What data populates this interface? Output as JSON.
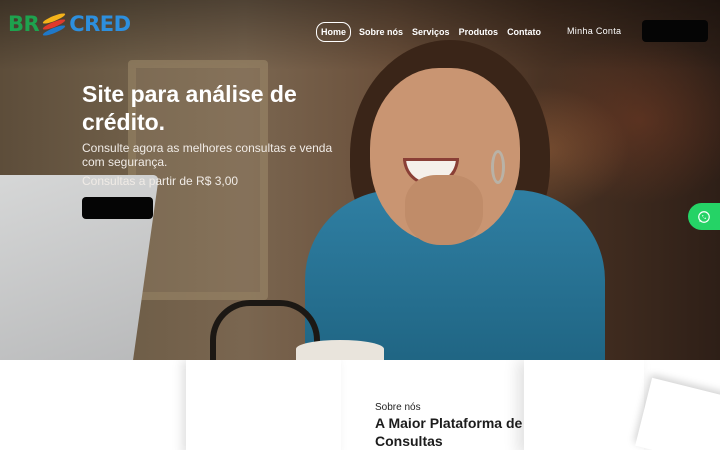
{
  "brand": {
    "logo_left": "BR",
    "logo_right": "CRED",
    "colors": {
      "green": "#1ea24e",
      "blue": "#2d8fde",
      "whatsapp": "#25d366",
      "button": "#050505"
    }
  },
  "nav": {
    "links": [
      {
        "label": "Home",
        "active": true
      },
      {
        "label": "Sobre nós",
        "active": false
      },
      {
        "label": "Serviços",
        "active": false
      },
      {
        "label": "Produtos",
        "active": false
      },
      {
        "label": "Contato",
        "active": false
      }
    ],
    "account_label": "Minha Conta",
    "cta_label": ""
  },
  "hero": {
    "title": "Site para análise de crédito.",
    "subtitle": "Consulte agora as melhores consultas e venda com segurança.",
    "price_text": "Consultas a partir de R$ 3,00",
    "cta_label": ""
  },
  "whatsapp": {
    "icon": "whatsapp-icon"
  },
  "about": {
    "eyebrow": "Sobre nós",
    "title": "A Maior Plataforma de Consultas"
  }
}
